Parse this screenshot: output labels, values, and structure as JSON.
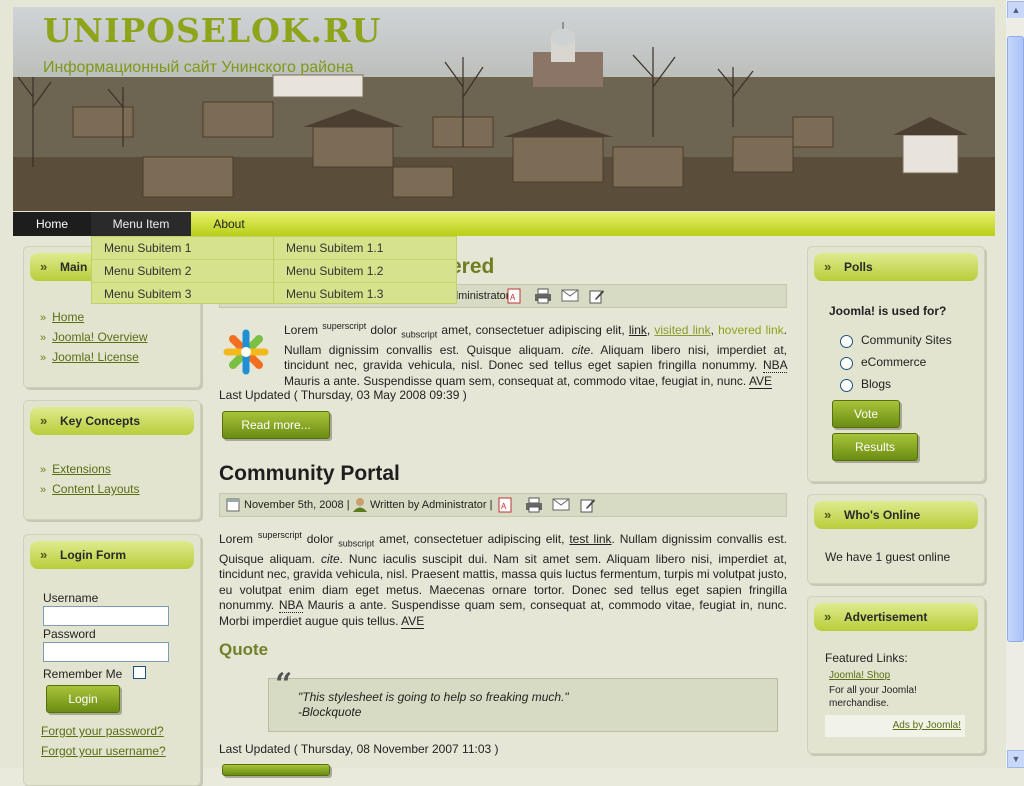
{
  "header": {
    "site_title": "UNIPOSELOK.RU",
    "site_subtitle": "Информационный сайт Унинского района"
  },
  "nav": {
    "items": [
      {
        "label": "Home"
      },
      {
        "label": "Menu Item"
      },
      {
        "label": "About"
      }
    ],
    "submenu_col1": [
      "Menu Subitem 1",
      "Menu Subitem 2",
      "Menu Subitem 3"
    ],
    "submenu_col2": [
      "Menu Subitem 1.1",
      "Menu Subitem 1.2",
      "Menu Subitem 1.3"
    ]
  },
  "left": {
    "main_menu": {
      "title": "Main",
      "items": [
        "Home",
        "Joomla! Overview",
        "Joomla! License"
      ]
    },
    "key_concepts": {
      "title": "Key Concepts",
      "items": [
        "Extensions",
        "Content Layouts"
      ]
    },
    "login": {
      "title": "Login Form",
      "username_label": "Username",
      "password_label": "Password",
      "remember_label": "Remember Me",
      "login_button": "Login",
      "forgot_password": "Forgot your password?",
      "forgot_username": "Forgot your username?"
    }
  },
  "articles": [
    {
      "title_visible": "ered",
      "meta_author": "dministrator |",
      "paragraph": {
        "lead": "Lorem ",
        "sup": "superscript",
        "t1": " dolor ",
        "sub": "subscript",
        "t2": " amet, consectetuer adipiscing elit, ",
        "link": "link",
        "comma": ", ",
        "visited": "visited link",
        "comma2": ", ",
        "hovered": "hovered link",
        "t3": ". Nullam dignissim convallis est. Quisque aliquam. ",
        "cite": "cite",
        "t4": ". Aliquam libero nisi, imperdiet at, tincidunt nec, gravida vehicula, nisl. Donec sed tellus eget sapien fringilla nonummy. ",
        "nba": "NBA",
        "t5": " Mauris a ante. Suspendisse quam sem, consequat at, commodo vitae, feugiat in, nunc. ",
        "ave": "AVE"
      },
      "updated": "Last Updated ( Thursday, 03 May 2008 09:39 )",
      "read_more": "Read more..."
    },
    {
      "title": "Community Portal",
      "date": "November 5th, 2008 |",
      "author": "Written by Administrator |",
      "paragraph": {
        "lead": "Lorem ",
        "sup": "superscript",
        "t1": " dolor ",
        "sub": "subscript",
        "t2": " amet, consectetuer adipiscing elit, ",
        "link": "test link",
        "t3": ". Nullam dignissim convallis est. Quisque aliquam. ",
        "cite": "cite",
        "t4": ". Nunc iaculis suscipit dui. Nam sit amet sem. Aliquam libero nisi, imperdiet at, tincidunt nec, gravida vehicula, nisl. Praesent mattis, massa quis luctus fermentum, turpis mi volutpat justo, eu volutpat enim diam eget metus. Maecenas ornare tortor. Donec sed tellus eget sapien fringilla nonummy. ",
        "nba": "NBA",
        "t5": " Mauris a ante. Suspendisse quam sem, consequat at, commodo vitae, feugiat in, nunc. Morbi imperdiet augue quis tellus. ",
        "ave": "AVE"
      },
      "quote_heading": "Quote",
      "quote_text": "\"This stylesheet is going to help so freaking much.\"",
      "quote_author": "-Blockquote",
      "updated": "Last Updated ( Thursday, 08 November 2007 11:03 )"
    }
  ],
  "right": {
    "polls": {
      "title": "Polls",
      "question": "Joomla! is used for?",
      "options": [
        "Community Sites",
        "eCommerce",
        "Blogs"
      ],
      "vote_button": "Vote",
      "results_button": "Results"
    },
    "whos_online": {
      "title": "Who's Online",
      "text": "We have 1 guest online"
    },
    "advertisement": {
      "title": "Advertisement",
      "featured": "Featured Links:",
      "shop_link": "Joomla! Shop",
      "shop_desc": "For all your Joomla! merchandise.",
      "ads_link": "Ads by Joomla!"
    }
  },
  "colors": {
    "accent_green": "#8ea41a",
    "nav_green": "#c6da2c",
    "link_green": "#5a6e12"
  }
}
